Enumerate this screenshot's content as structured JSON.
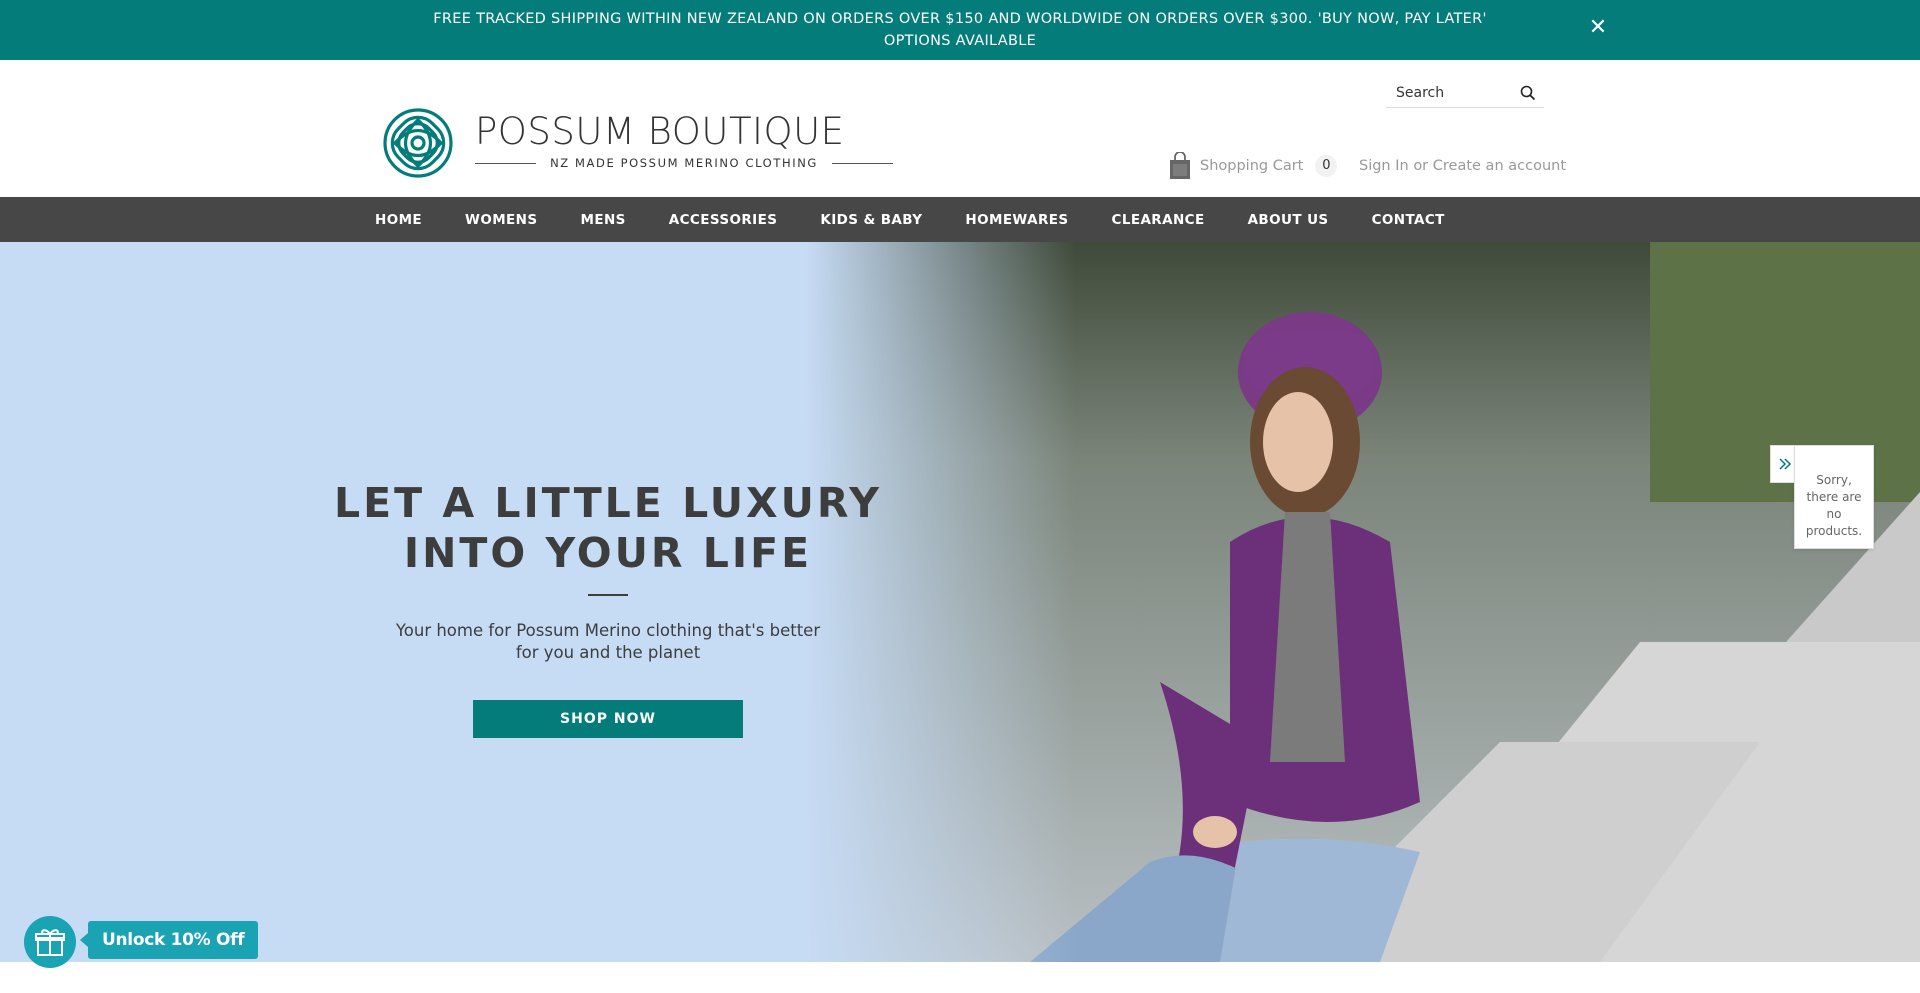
{
  "announcement": {
    "text": "FREE TRACKED SHIPPING WITHIN NEW ZEALAND ON ORDERS OVER $150 AND WORLDWIDE ON ORDERS OVER $300. 'BUY NOW, PAY LATER' OPTIONS AVAILABLE",
    "close_icon": "close-icon",
    "close_glyph": "✕"
  },
  "header": {
    "logo": {
      "name": "POSSUM BOUTIQUE",
      "tagline": "NZ MADE POSSUM MERINO CLOTHING"
    },
    "search": {
      "placeholder": "Search",
      "icon": "search-icon"
    },
    "cart": {
      "label": "Shopping Cart",
      "count": "0",
      "icon": "shopping-bag-icon"
    },
    "account": {
      "sign_in": "Sign In",
      "separator": "or",
      "create": "Create an account"
    }
  },
  "nav": {
    "items": [
      "HOME",
      "WOMENS",
      "MENS",
      "ACCESSORIES",
      "KIDS & BABY",
      "HOMEWARES",
      "CLEARANCE",
      "ABOUT US",
      "CONTACT"
    ]
  },
  "hero": {
    "title": "LET A LITTLE LUXURY INTO YOUR LIFE",
    "subtitle": "Your home for Possum Merino clothing that's better for you and the planet",
    "cta": "SHOP NOW"
  },
  "widget": {
    "toggle_icon": "double-chevron-right-icon",
    "message": "Sorry, there are no products."
  },
  "rewards": {
    "icon": "gift-icon",
    "label": "Unlock 10% Off"
  },
  "colors": {
    "teal": "#037c7a",
    "nav": "#474747",
    "hero_sky": "#c6dbf4",
    "reward": "#1aa3b3"
  }
}
